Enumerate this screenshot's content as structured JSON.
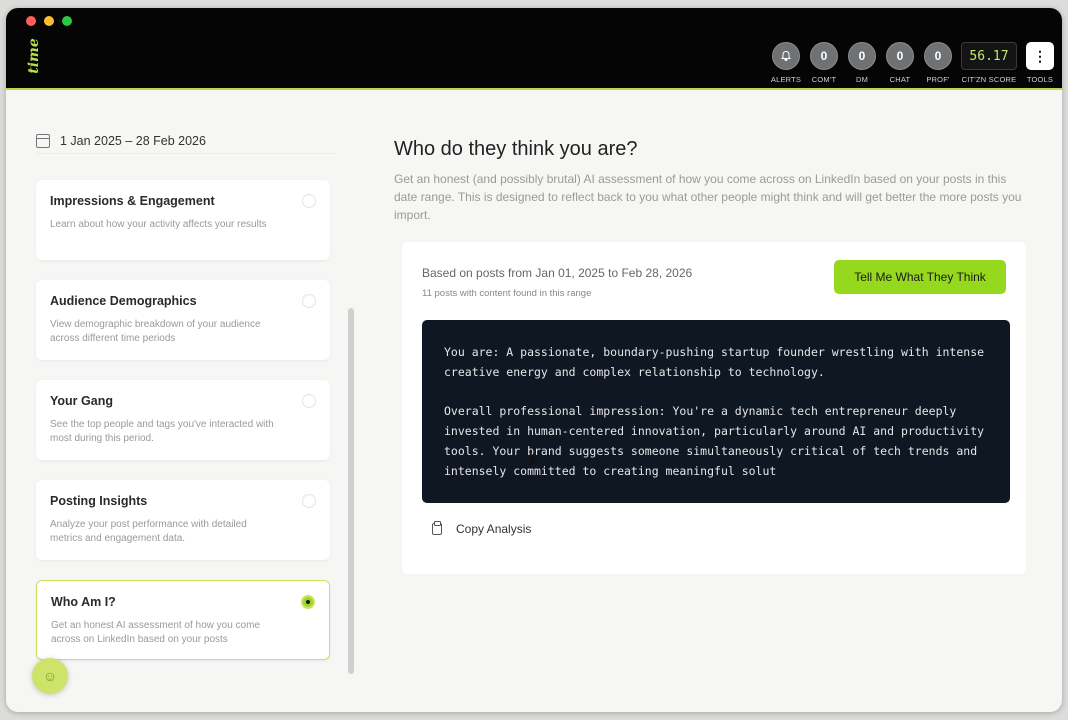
{
  "app": {
    "logo": "time"
  },
  "metrics": [
    {
      "value": "0",
      "label": "COM'T",
      "name": "comments-counter"
    },
    {
      "value": "0",
      "label": "DM",
      "name": "dm-counter"
    },
    {
      "value": "0",
      "label": "CHAT",
      "name": "chat-counter"
    },
    {
      "value": "0",
      "label": "PROF'",
      "name": "profile-counter"
    }
  ],
  "alerts": {
    "label": "ALERTS",
    "icon": "bell-icon"
  },
  "score": {
    "value": "56.17",
    "label": "CIT'ZN SCORE"
  },
  "tools": {
    "label": "TOOLS",
    "icon": "more-vertical-icon"
  },
  "sidebar": {
    "date_range": "1 Jan 2025 – 28 Feb 2026",
    "items": [
      {
        "title": "Impressions & Engagement",
        "desc": "Learn about how your activity affects your results"
      },
      {
        "title": "Audience Demographics",
        "desc": "View demographic breakdown of your audience across different time periods"
      },
      {
        "title": "Your Gang",
        "desc": "See the top people and tags you've interacted with most during this period."
      },
      {
        "title": "Posting Insights",
        "desc": "Analyze your post performance with detailed metrics and engagement data."
      },
      {
        "title": "Who Am I?",
        "desc": "Get an honest AI assessment of how you come across on LinkedIn based on your posts"
      }
    ]
  },
  "main": {
    "title": "Who do they think you are?",
    "desc": "Get an honest (and possibly brutal) AI assessment of how you come across on LinkedIn based on your posts in this date range. This is designed to reflect back to you what other people might think and will get better the more posts you import.",
    "based_on": "Based on posts from Jan 01, 2025 to Feb 28, 2026",
    "posts_count": "11 posts with content found in this range",
    "cta_label": "Tell Me What They Think",
    "analysis_p1": "You are: A passionate, boundary-pushing startup founder wrestling with intense creative energy and complex relationship to technology.",
    "analysis_p2": "Overall professional impression: You're a dynamic tech entrepreneur deeply invested in human-centered innovation, particularly around AI and productivity tools. Your brand suggests someone simultaneously critical of tech trends and intensely committed to creating meaningful solut",
    "copy_label": "Copy Analysis"
  },
  "colors": {
    "accent": "#96d81e",
    "topbar": "#050505",
    "analysis_bg": "#0f1723"
  }
}
